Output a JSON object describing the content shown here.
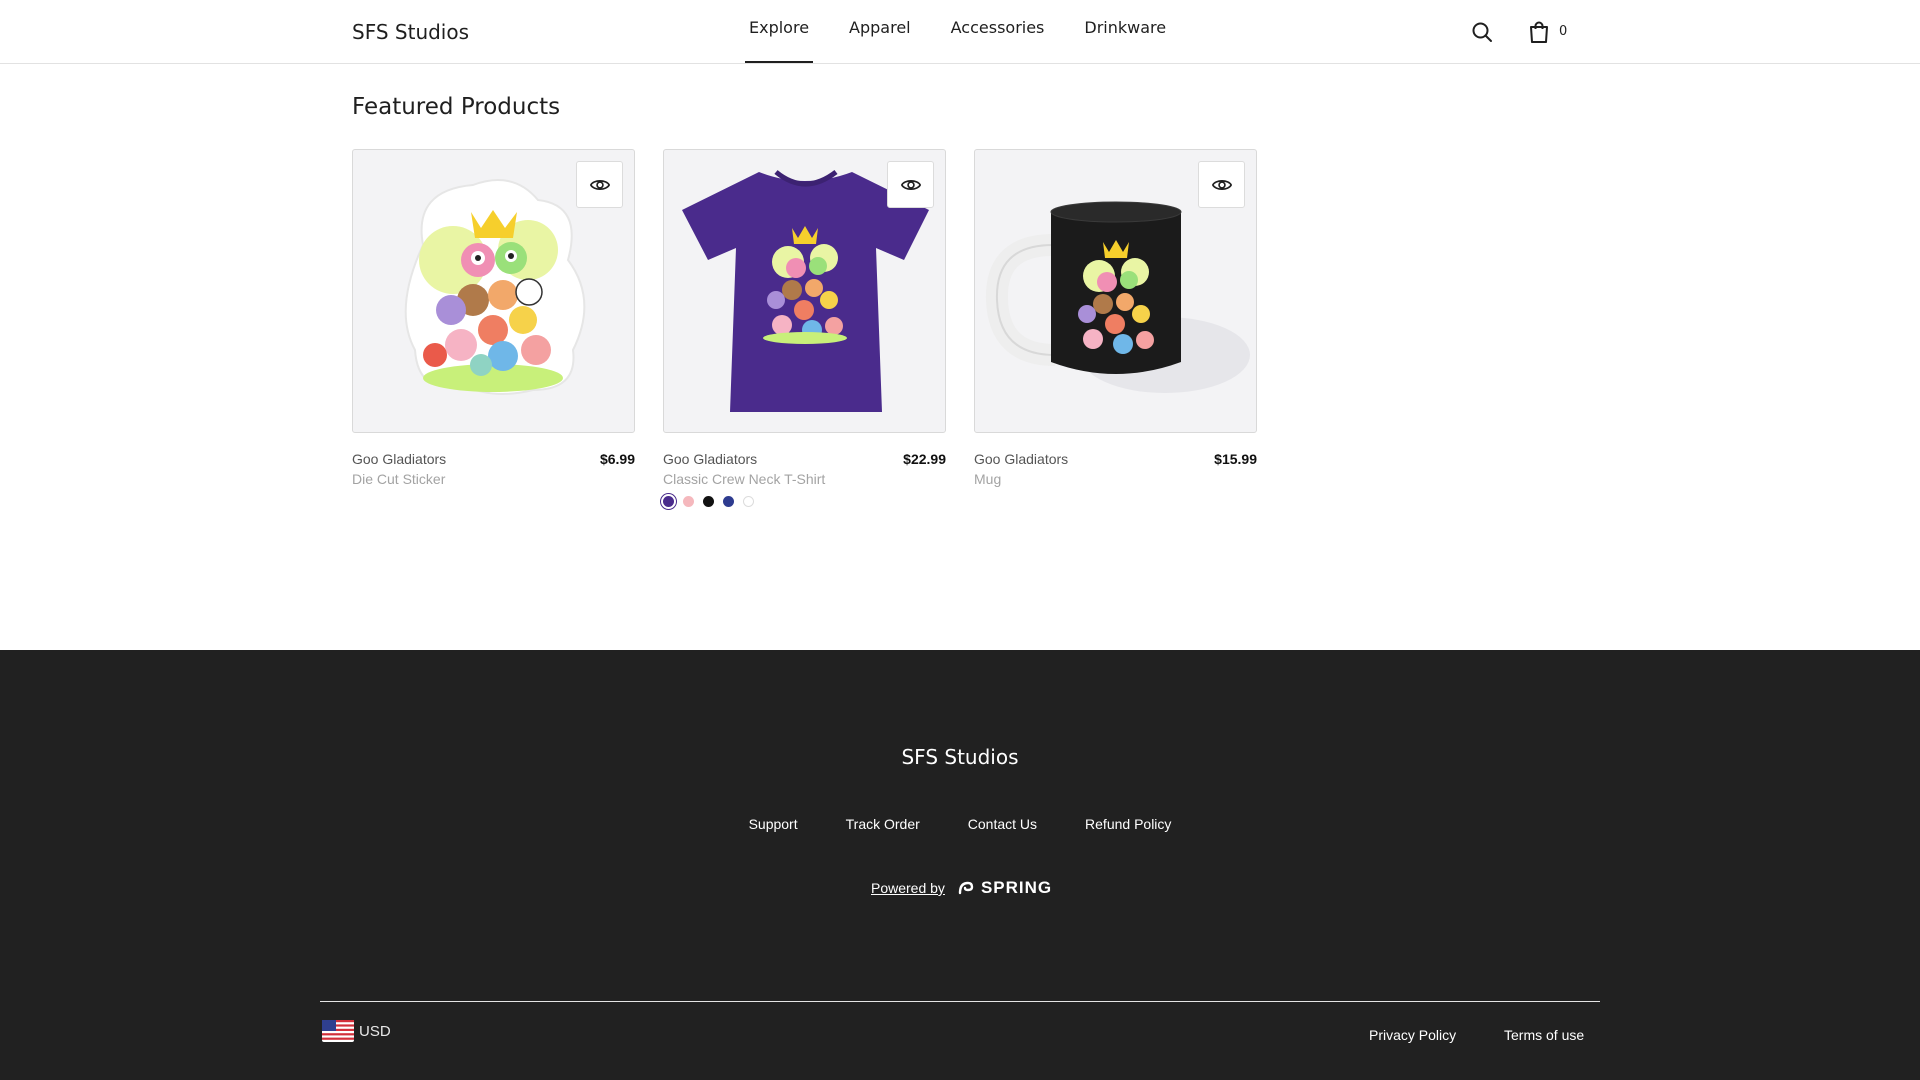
{
  "header": {
    "brand": "SFS Studios",
    "nav": [
      {
        "label": "Explore",
        "active": true
      },
      {
        "label": "Apparel",
        "active": false
      },
      {
        "label": "Accessories",
        "active": false
      },
      {
        "label": "Drinkware",
        "active": false
      }
    ],
    "cart_count": "0"
  },
  "main": {
    "section_title": "Featured Products",
    "products": [
      {
        "title": "Goo Gladiators",
        "subtitle": "Die Cut Sticker",
        "price": "$6.99",
        "image": "sticker-art"
      },
      {
        "title": "Goo Gladiators",
        "subtitle": "Classic Crew Neck T-Shirt",
        "price": "$22.99",
        "image": "tshirt-art",
        "swatches": [
          "#4a2b8c",
          "#f5b8bd",
          "#111111",
          "#2e3b8f",
          "#ffffff"
        ]
      },
      {
        "title": "Goo Gladiators",
        "subtitle": "Mug",
        "price": "$15.99",
        "image": "mug-art"
      }
    ]
  },
  "footer": {
    "brand": "SFS Studios",
    "links": [
      "Support",
      "Track Order",
      "Contact Us",
      "Refund Policy"
    ],
    "powered_by": "Powered by",
    "spring_logo": "SPRING",
    "currency": "USD",
    "privacy": "Privacy Policy",
    "terms": "Terms of use"
  },
  "colors": {
    "accent": "#4a2b8c",
    "footer_bg": "#212121",
    "text": "#1f1f1f"
  }
}
